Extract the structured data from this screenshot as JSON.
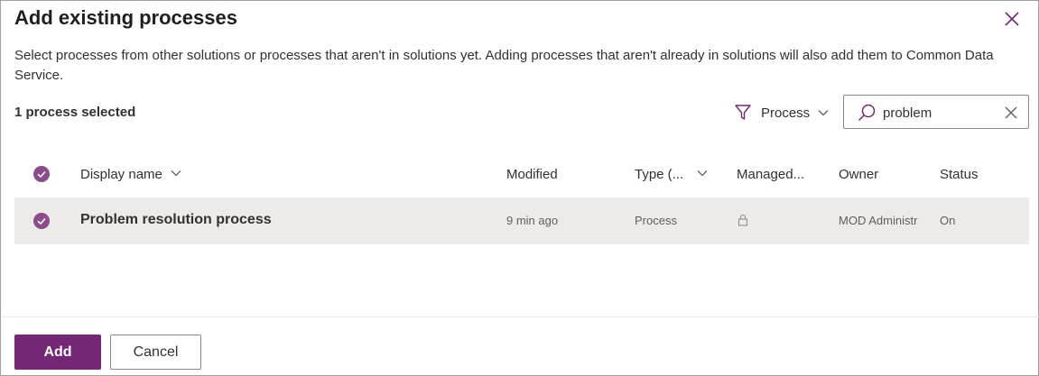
{
  "dialog": {
    "title": "Add existing processes",
    "description": "Select processes from other solutions or processes that aren't in solutions yet. Adding processes that aren't already in solutions will also add them to Common Data Service.",
    "selection_count": "1 process selected"
  },
  "filter": {
    "label": "Process",
    "icon": "filter-icon"
  },
  "search": {
    "value": "problem",
    "placeholder": "Search"
  },
  "columns": {
    "display_name": "Display name",
    "modified": "Modified",
    "type": "Type (...",
    "managed": "Managed...",
    "owner": "Owner",
    "status": "Status"
  },
  "rows": [
    {
      "display_name": "Problem resolution process",
      "modified": "9 min ago",
      "type": "Process",
      "owner": "MOD Administr",
      "status": "On",
      "selected": true
    }
  ],
  "buttons": {
    "add": "Add",
    "cancel": "Cancel"
  },
  "colors": {
    "accent": "#742774",
    "check": "#8a4d8a",
    "row_selected": "#edebe9"
  }
}
